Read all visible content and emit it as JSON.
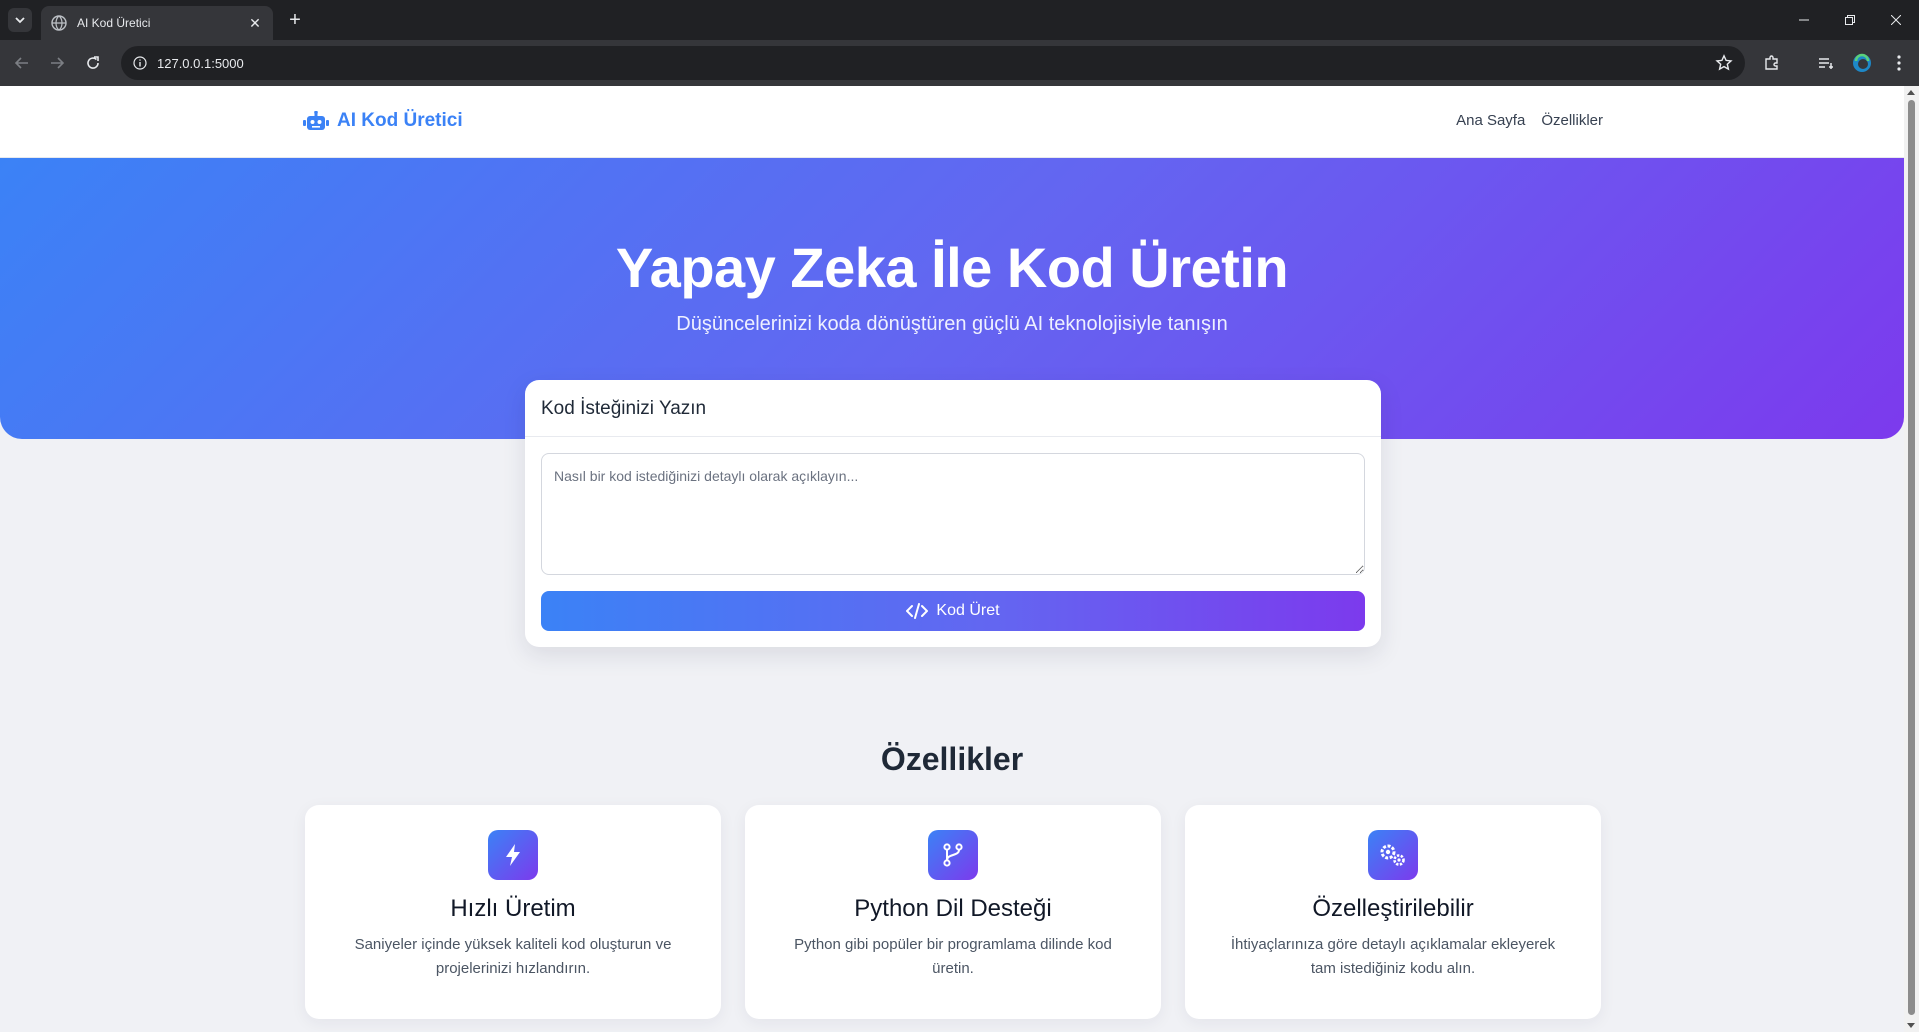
{
  "browser": {
    "tab_title": "AI Kod Üretici",
    "new_tab": "+",
    "url": "127.0.0.1:5000"
  },
  "site": {
    "brand": "AI Kod Üretici",
    "nav": [
      "Ana Sayfa",
      "Özellikler"
    ]
  },
  "hero": {
    "title": "Yapay Zeka İle Kod Üretin",
    "subtitle": "Düşüncelerinizi koda dönüştüren güçlü AI teknolojisiyle tanışın"
  },
  "request_card": {
    "title": "Kod İsteğinizi Yazın",
    "placeholder": "Nasıl bir kod istediğinizi detaylı olarak açıklayın...",
    "value": "",
    "button_label": "Kod Üret"
  },
  "features": {
    "title": "Özellikler",
    "items": [
      {
        "icon": "bolt-icon",
        "title": "Hızlı Üretim",
        "text": "Saniyeler içinde yüksek kaliteli kod oluşturun ve projelerinizi hızlandırın."
      },
      {
        "icon": "code-branch-icon",
        "title": "Python Dil Desteği",
        "text": "Python gibi popüler bir programlama dilinde kod üretin."
      },
      {
        "icon": "cogs-icon",
        "title": "Özelleştirilebilir",
        "text": "İhtiyaçlarınıza göre detaylı açıklamalar ekleyerek tam istediğiniz kodu alın."
      }
    ]
  },
  "colors": {
    "accent": "#3b82f6",
    "gradient_start": "#3b82f6",
    "gradient_end": "#7c3aed",
    "page_bg": "#f0f1f5"
  }
}
